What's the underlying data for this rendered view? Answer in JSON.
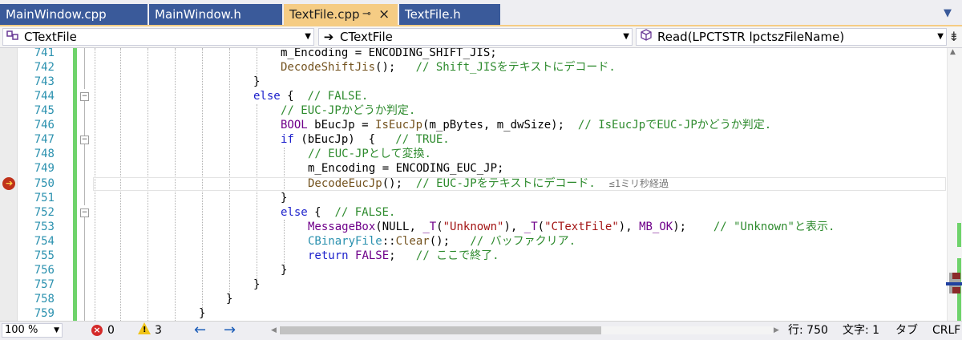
{
  "tabs": [
    {
      "label": "MainWindow.cpp",
      "active": false
    },
    {
      "label": "MainWindow.h",
      "active": false
    },
    {
      "label": "TextFile.cpp",
      "active": true,
      "pin": "⊸",
      "close": "×"
    },
    {
      "label": "TextFile.h",
      "active": false
    }
  ],
  "tab_overflow": "▼",
  "navbar": {
    "project_icon": "class-icon",
    "project": "CTextFile",
    "scope_icon": "arrow-right-icon",
    "scope": "CTextFile",
    "member_icon": "method-cube-icon",
    "member": "Read(LPCTSTR lpctszFileName)",
    "split_icon": "split-icon"
  },
  "gutter": {
    "line_numbers": [
      "741",
      "742",
      "743",
      "744",
      "745",
      "746",
      "747",
      "748",
      "749",
      "750",
      "751",
      "752",
      "753",
      "754",
      "755",
      "756",
      "757",
      "758",
      "759"
    ],
    "breakpoint_line": "750",
    "breakpoint_icon": "current-statement-breakpoint-icon"
  },
  "code": {
    "l741": {
      "a": "m_Encoding = ENCODING_SHIFT_JIS;"
    },
    "l742": {
      "fn": "DecodeShiftJis",
      "rest": "();   ",
      "cm": "// Shift_JISをテキストにデコード."
    },
    "l743": {
      "brace": "}"
    },
    "l744": {
      "kw": "else",
      "rest": " {  ",
      "cm": "// FALSE."
    },
    "l745": {
      "cm": "// EUC-JPかどうか判定."
    },
    "l746": {
      "mac": "BOOL",
      "a": " bEucJp = ",
      "fn": "IsEucJp",
      "b": "(m_pBytes, m_dwSize);  ",
      "cm": "// IsEucJpでEUC-JPかどうか判定."
    },
    "l747": {
      "kw": "if",
      "a": " (bEucJp)  {   ",
      "cm": "// TRUE."
    },
    "l748": {
      "cm": "// EUC-JPとして変換."
    },
    "l749": {
      "a": "m_Encoding = ENCODING_EUC_JP;"
    },
    "l750": {
      "fn": "DecodeEucJp",
      "rest": "();  ",
      "cm": "// EUC-JPをテキストにデコード.",
      "perf": "≤1ミリ秒経過"
    },
    "l751": {
      "brace": "}"
    },
    "l752": {
      "kw": "else",
      "rest": " {  ",
      "cm": "// FALSE."
    },
    "l753": {
      "mac": "MessageBox",
      "a": "(NULL, ",
      "mac2": "_T",
      "b": "(",
      "st1": "\"Unknown\"",
      "c": "), ",
      "mac3": "_T",
      "d": "(",
      "st2": "\"CTextFile\"",
      "e": "), ",
      "mac4": "MB_OK",
      "f": ");    ",
      "cm": "// \"Unknown\"と表示."
    },
    "l754": {
      "cl": "CBinaryFile",
      "a": "::",
      "fn": "Clear",
      "rest": "();   ",
      "cm": "// バッファクリア."
    },
    "l755": {
      "kw": "return",
      "a": " ",
      "mac": "FALSE",
      "rest": ";   ",
      "cm": "// ここで終了."
    },
    "l756": {
      "brace": "}"
    },
    "l757": {
      "brace": "}"
    },
    "l758": {
      "brace": "}"
    },
    "l759": {
      "brace": "}"
    }
  },
  "status": {
    "zoom": "100 %",
    "error_count": "0",
    "warning_count": "3",
    "line": "行: 750",
    "column": "文字: 1",
    "indent": "タブ",
    "eol": "CRLF"
  },
  "colors": {
    "active_tab": "#f5cc84",
    "inactive_tab": "#3a5a9a",
    "line_number": "#2b91af",
    "keyword": "#1e22cc",
    "comment": "#2e8b2e",
    "change_bar": "#6fd36b"
  }
}
